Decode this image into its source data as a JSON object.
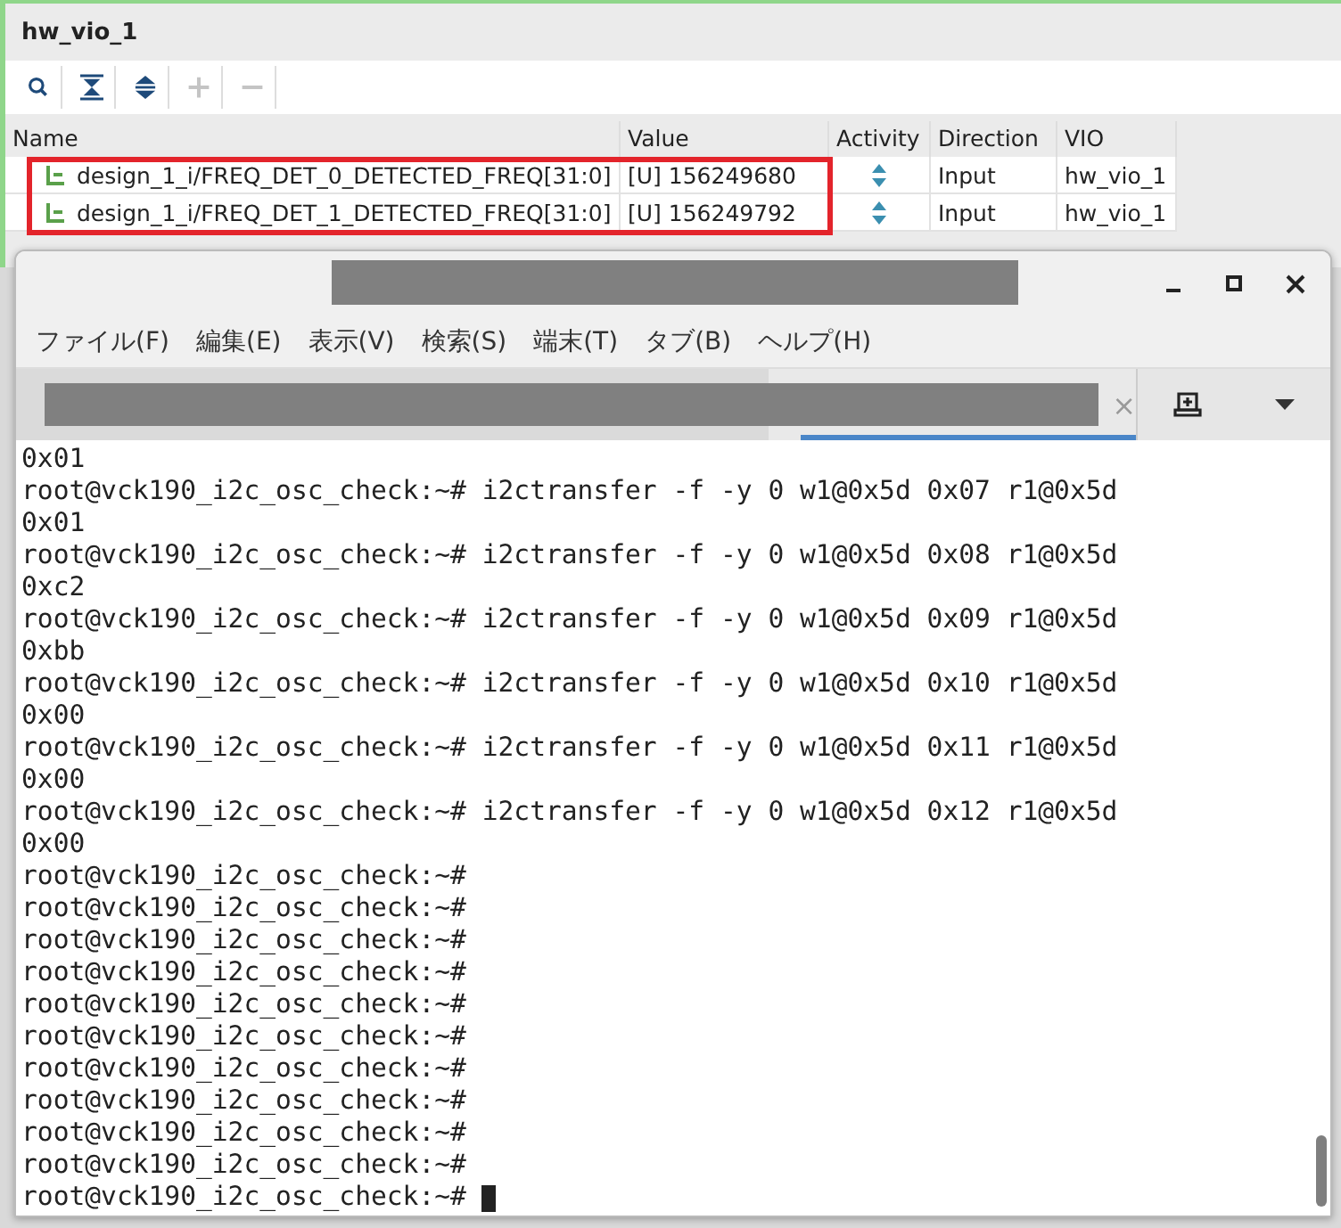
{
  "vio_panel": {
    "title": "hw_vio_1",
    "table": {
      "columns": [
        "Name",
        "Value",
        "Activity",
        "Direction",
        "VIO"
      ],
      "highlighted": true,
      "rows": [
        {
          "name": "design_1_i/FREQ_DET_0_DETECTED_FREQ[31:0]",
          "value": "[U] 156249680",
          "direction": "Input",
          "vio": "hw_vio_1"
        },
        {
          "name": "design_1_i/FREQ_DET_1_DETECTED_FREQ[31:0]",
          "value": "[U] 156249792",
          "direction": "Input",
          "vio": "hw_vio_1"
        }
      ]
    }
  },
  "terminal": {
    "menu": [
      "ファイル(F)",
      "編集(E)",
      "表示(V)",
      "検索(S)",
      "端末(T)",
      "タブ(B)",
      "ヘルプ(H)"
    ],
    "tab_close": "×",
    "lines": [
      "0x01",
      "root@vck190_i2c_osc_check:~# i2ctransfer -f -y 0 w1@0x5d 0x07 r1@0x5d",
      "0x01",
      "root@vck190_i2c_osc_check:~# i2ctransfer -f -y 0 w1@0x5d 0x08 r1@0x5d",
      "0xc2",
      "root@vck190_i2c_osc_check:~# i2ctransfer -f -y 0 w1@0x5d 0x09 r1@0x5d",
      "0xbb",
      "root@vck190_i2c_osc_check:~# i2ctransfer -f -y 0 w1@0x5d 0x10 r1@0x5d",
      "0x00",
      "root@vck190_i2c_osc_check:~# i2ctransfer -f -y 0 w1@0x5d 0x11 r1@0x5d",
      "0x00",
      "root@vck190_i2c_osc_check:~# i2ctransfer -f -y 0 w1@0x5d 0x12 r1@0x5d",
      "0x00",
      "root@vck190_i2c_osc_check:~#",
      "root@vck190_i2c_osc_check:~#",
      "root@vck190_i2c_osc_check:~#",
      "root@vck190_i2c_osc_check:~#",
      "root@vck190_i2c_osc_check:~#",
      "root@vck190_i2c_osc_check:~#",
      "root@vck190_i2c_osc_check:~#",
      "root@vck190_i2c_osc_check:~#",
      "root@vck190_i2c_osc_check:~#",
      "root@vck190_i2c_osc_check:~#",
      "root@vck190_i2c_osc_check:~#"
    ]
  }
}
